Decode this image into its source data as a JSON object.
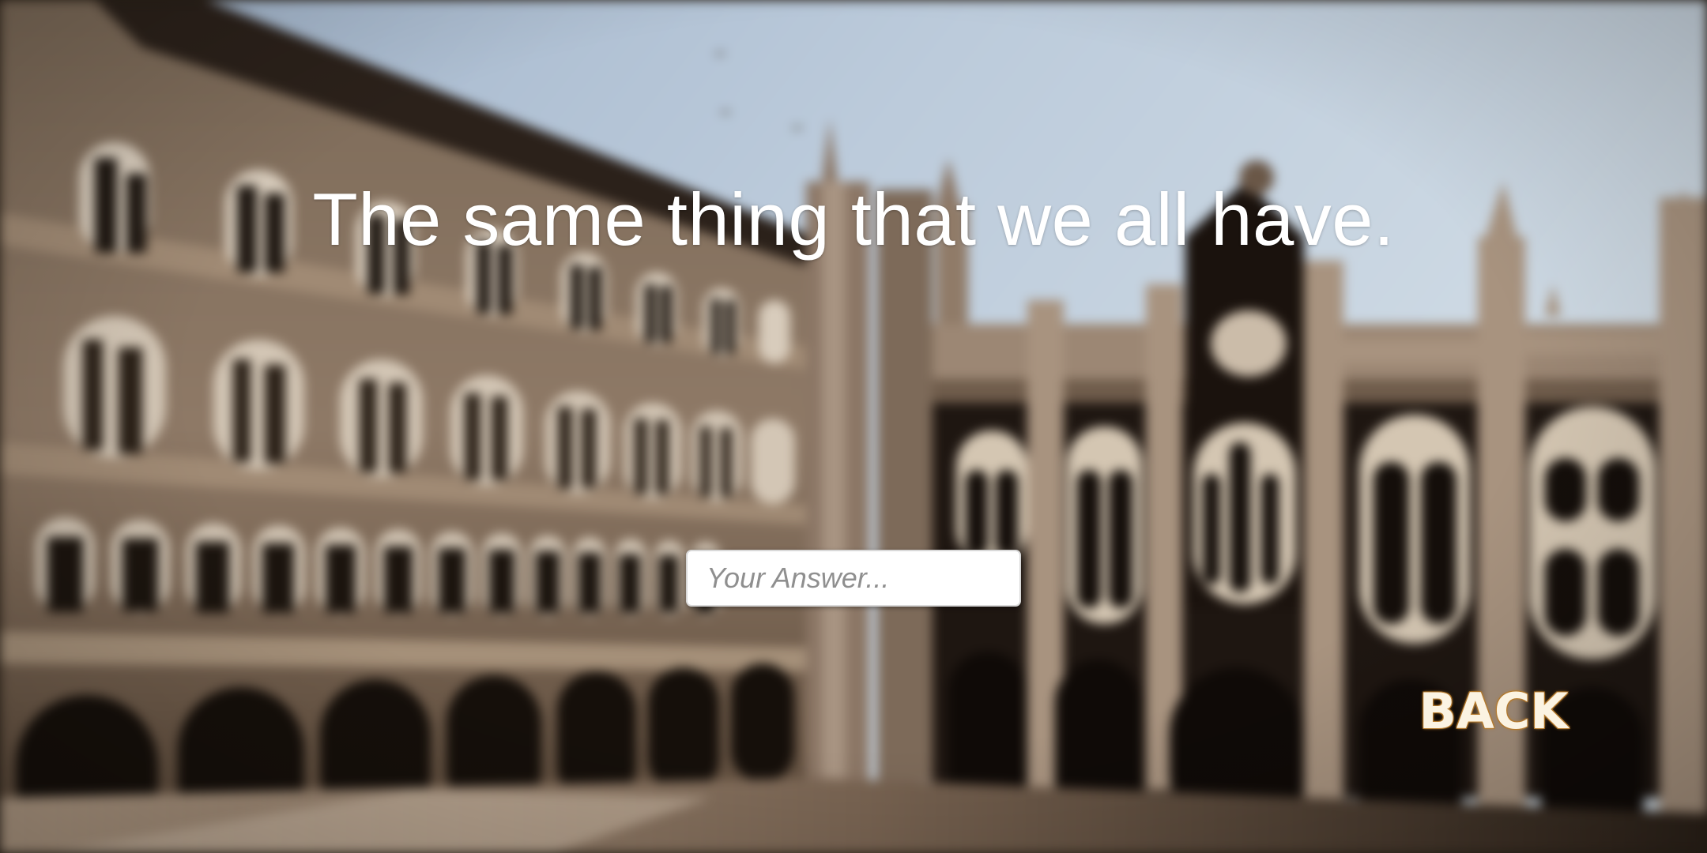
{
  "question": {
    "text": "The same thing that we all have."
  },
  "answer_input": {
    "placeholder": "Your Answer...",
    "value": ""
  },
  "back_button": {
    "label": "BACK"
  },
  "background": {
    "description_icon": "blurred-building-photo",
    "sky_color": "#b9cbdc",
    "stone_color": "#8a7560",
    "shadow_color": "#1e1611"
  }
}
